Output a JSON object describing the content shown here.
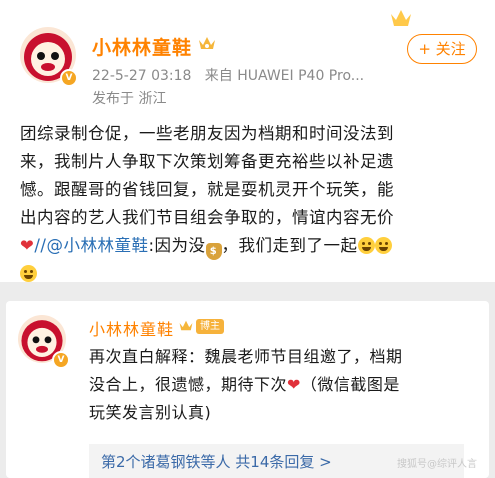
{
  "post": {
    "author": "小林林童鞋",
    "timestamp": "22-5-27 03:18",
    "source": "来自 HUAWEI P40 Pro...",
    "location": "发布于 浙江",
    "follow_label": "+ 关注",
    "body_line1": "团综录制仓促，一些老朋友因为档期和时间没法到",
    "body_line2": "来，我制片人争取下次策划筹备更充裕些以补足遗",
    "body_line3": "憾。跟醒哥的省钱回复，就是耍机灵开个玩笑，能",
    "body_line4": "出内容的艺人我们节目组会争取的，情谊内容无价",
    "body_heart": "❤",
    "body_mention": "//@小林林童鞋",
    "body_line5_mid": ":因为没",
    "body_line5_end": "，我们走到了一起",
    "icons": [
      "crown-icon",
      "heart-icon",
      "money-bag-icon",
      "laugh-cry-icon"
    ]
  },
  "comment": {
    "author": "小林林童鞋",
    "badge": "博主",
    "line1": "再次直白解释：魏晨老师节目组邀了，档期",
    "line2": "没合上，很遗憾，期待下次",
    "line2_end": "（微信截图是",
    "line3": "玩笑发言别认真)",
    "replies_summary": "第2个诸葛钢铁等人  共14条回复 >",
    "watermark": "搜狐号@综评人言"
  },
  "colors": {
    "accent": "#ff8200",
    "link": "#2a6fb5",
    "heart": "#e0313a"
  }
}
